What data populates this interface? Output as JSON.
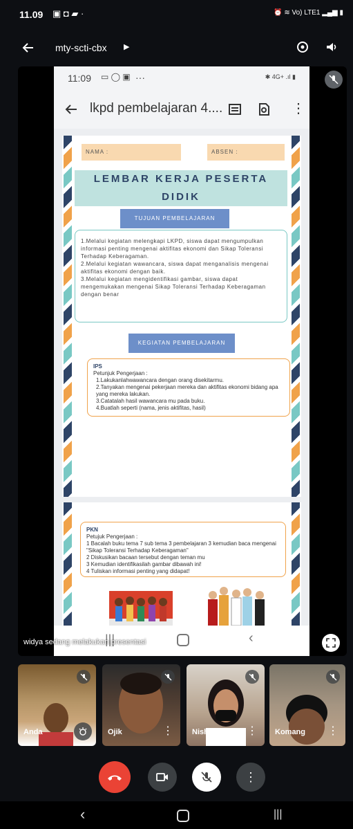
{
  "status_bar": {
    "time": "11.09",
    "right_text": "Vo) LTE1"
  },
  "top_bar": {
    "meeting_code": "mty-scti-cbx"
  },
  "phone": {
    "time": "11:09",
    "dots": "···",
    "doc_title": "lkpd pembelajaran 4....",
    "right_icons": "4G+"
  },
  "worksheet": {
    "nama_label": "NAMA :",
    "absen_label": "ABSEN :",
    "title": "LEMBAR KERJA PESERTA DIDIK",
    "tujuan_heading": "TUJUAN PEMBELAJARAN",
    "tujuan_items": [
      "1.Melalui kegiatan melengkapi LKPD, siswa dapat mengumpulkan informasi penting mengenai aktifitas ekonomi dan Sikap Toleransi Terhadap Keberagaman.",
      "2.Melalui kegiatan wawancara, siswa dapat menganalisis mengenai aktifitas ekonomi dengan baik.",
      "3.Melalui kegiatan mengidentifikasi gambar, siswa dapat mengemukakan mengenai Sikap Toleransi Terhadap Keberagaman dengan benar"
    ],
    "kegiatan_heading": "KEGIATAN PEMBELAJARAN",
    "ips_title": "IPS",
    "ips_subtitle": "Petunjuk Pengerjaan :",
    "ips_items": [
      "1.Lakukanlahwawancara dengan orang disekitarmu.",
      "2.Tanyakan mengenai pekerjaan mereka dan aktifitas ekonomi bidang apa yang mereka lakukan.",
      "3.Catatalah hasil wawancara mu pada buku.",
      "4.Buatlah seperti (nama, jenis aktifitas, hasil)"
    ],
    "pkn_title": "PKN",
    "pkn_subtitle": "Petujuk Pengerjaan :",
    "pkn_items": [
      "1 Bacalah buku tema 7 sub tema 3 pembelajaran 3 kemudian baca mengenai \"Sikap Toleransi Terhadap Keberagaman\"",
      "2 Diskusikan bacaan tersebut dengan teman mu",
      "3 Kemudian identifikasilah gambar dibawah ini!",
      "4 Tuliskan informasi penting yang didapat!"
    ]
  },
  "presentation_caption": "widya sedang melakukan presentasi",
  "participants": [
    {
      "name": "Anda"
    },
    {
      "name": "Ojik"
    },
    {
      "name": "Nishimura"
    },
    {
      "name": "Komang"
    }
  ],
  "colors": {
    "end_call": "#ea4335",
    "navy": "#2e4467",
    "teal": "#79c8c4",
    "orange": "#f0a24a"
  }
}
